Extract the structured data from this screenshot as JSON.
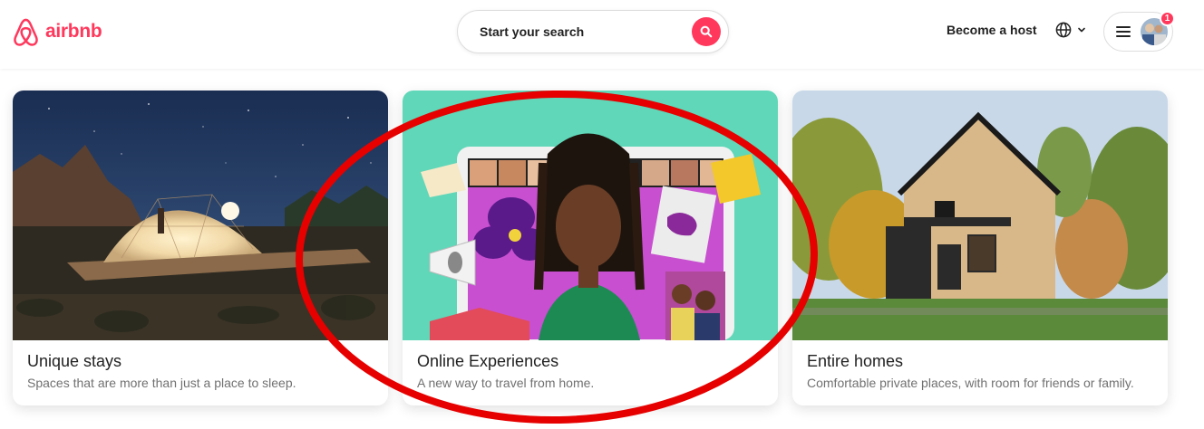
{
  "brand": {
    "name": "airbnb",
    "color": "#FF385C"
  },
  "search": {
    "label": "Start your search",
    "icon": "search-icon"
  },
  "header": {
    "host_link": "Become a host",
    "language_icon": "globe-icon",
    "menu_icon": "hamburger-menu-icon",
    "notification_count": "1"
  },
  "cards": [
    {
      "title": "Unique stays",
      "subtitle": "Spaces that are more than just a place to sleep."
    },
    {
      "title": "Online Experiences",
      "subtitle": "A new way to travel from home."
    },
    {
      "title": "Entire homes",
      "subtitle": "Comfortable private places, with room for friends or family."
    }
  ],
  "colors": {
    "accent": "#FF385C",
    "annotation": "#E60000",
    "text": "#222222",
    "muted": "#717171"
  }
}
